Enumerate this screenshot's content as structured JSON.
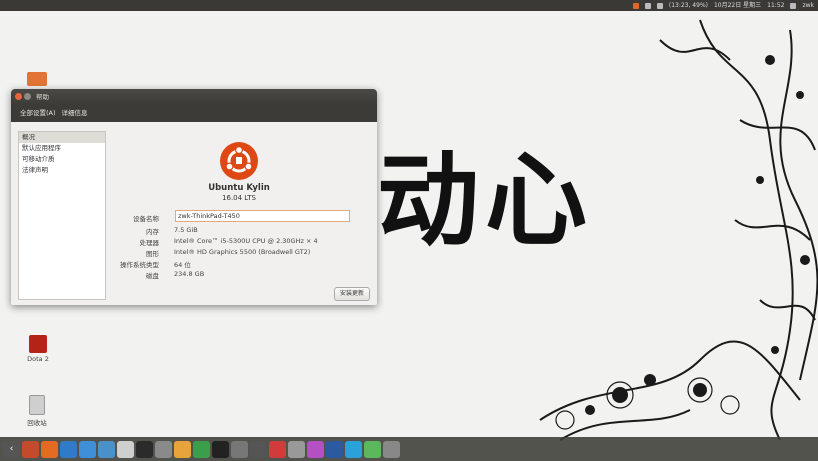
{
  "topbar": {
    "tray_items": [
      "(13:23, 49%)",
      "10月22日 星期三",
      "11:52",
      "zwk"
    ]
  },
  "desktop": {
    "wallpaper_text": "动心",
    "icons": [
      {
        "label": "",
        "icon": "folder-icon"
      },
      {
        "label": "Dota 2",
        "icon": "dota2-icon"
      },
      {
        "label": "回收站",
        "icon": "trash-icon"
      }
    ]
  },
  "window": {
    "title": "帮助",
    "toolbar": {
      "all_settings": "全部设置(A)",
      "details": "详细信息"
    },
    "sidebar": {
      "items": [
        {
          "label": "概况",
          "active": true
        },
        {
          "label": "默认应用程序",
          "active": false
        },
        {
          "label": "可移动介质",
          "active": false
        },
        {
          "label": "法律声明",
          "active": false
        }
      ]
    },
    "product": {
      "name": "Ubuntu Kylin",
      "version": "16.04 LTS"
    },
    "info": {
      "device_name_label": "设备名称",
      "device_name_value": "zwk-ThinkPad-T450",
      "memory_label": "内存",
      "memory_value": "7.5 GiB",
      "processor_label": "处理器",
      "processor_value": "Intel® Core™ i5-5300U CPU @ 2.30GHz × 4",
      "graphics_label": "图形",
      "graphics_value": "Intel® HD Graphics 5500 (Broadwell GT2)",
      "os_type_label": "操作系统类型",
      "os_type_value": "64 位",
      "disk_label": "磁盘",
      "disk_value": "234.8 GB"
    },
    "install_updates": "安装更新"
  },
  "colors": {
    "ubuntu_orange": "#dd4814",
    "titlebar": "#3c3b37",
    "launcher": "#3c3c37"
  }
}
